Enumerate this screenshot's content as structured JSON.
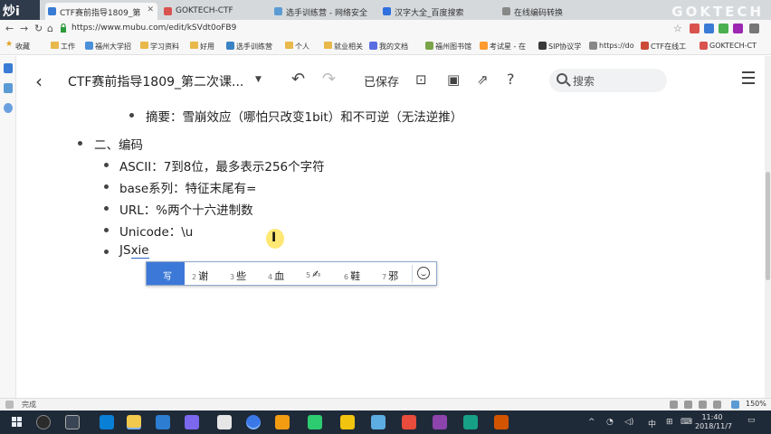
{
  "browser": {
    "avatar_text": "炒i",
    "watermark": "GOKTECH",
    "tabs": [
      {
        "label": "CTF赛前指导1809_第",
        "color": "#3a7bd5",
        "active": true
      },
      {
        "label": "GOKTECH-CTF",
        "color": "#d9534f",
        "active": false
      },
      {
        "label": "选手训练营 - 网络安全",
        "color": "#5b9bd5",
        "active": false
      },
      {
        "label": "汉字大全_百度搜索",
        "color": "#2f6fde",
        "active": false
      },
      {
        "label": "在线编码转换",
        "color": "#888888",
        "active": false
      }
    ],
    "url": "https://www.mubu.com/edit/kSVdt0oFB9"
  },
  "bookmarks": [
    {
      "label": "收藏",
      "type": "star"
    },
    {
      "label": "工作",
      "type": "folder"
    },
    {
      "label": "福州大学招",
      "type": "page",
      "color": "#4a90d9"
    },
    {
      "label": "学习资料",
      "type": "folder"
    },
    {
      "label": "好用",
      "type": "folder"
    },
    {
      "label": "选手训练营",
      "type": "page",
      "color": "#3b82c4"
    },
    {
      "label": "个人",
      "type": "folder"
    },
    {
      "label": "就业相关",
      "type": "folder"
    },
    {
      "label": "我的文档",
      "type": "page",
      "color": "#5b6ee1"
    },
    {
      "label": "福州图书馆",
      "type": "page",
      "color": "#7aa34a"
    },
    {
      "label": "考试星 - 在",
      "type": "page",
      "color": "#ff9a2e"
    },
    {
      "label": "SIP协议学",
      "type": "page",
      "color": "#3a3a3a"
    },
    {
      "label": "https://do",
      "type": "page",
      "color": "#888888"
    },
    {
      "label": "CTF在线工",
      "type": "page",
      "color": "#cc4b37"
    },
    {
      "label": "GOKTECH-CT",
      "type": "page",
      "color": "#d9534f"
    }
  ],
  "doc": {
    "title": "CTF赛前指导1809_第二次课...",
    "saved_status": "已保存",
    "search_placeholder": "搜索"
  },
  "outline": {
    "line0": "摘要：雪崩效应（哪怕只改变1bit）和不可逆（无法逆推）",
    "section": "二、编码",
    "items": [
      "ASCII：7到8位，最多表示256个字符",
      "base系列：特征末尾有=",
      "URL：%两个十六进制数",
      "Unicode：\\u"
    ],
    "current_prefix": "JS",
    "current_composing": "xie"
  },
  "ime": {
    "selected": "写",
    "candidates": [
      {
        "num": "2",
        "text": "谢"
      },
      {
        "num": "3",
        "text": "些"
      },
      {
        "num": "4",
        "text": "血"
      },
      {
        "num": "5",
        "text": "✍"
      },
      {
        "num": "6",
        "text": "鞋"
      },
      {
        "num": "7",
        "text": "邪"
      }
    ]
  },
  "statusbar": {
    "status": "完成",
    "zoom": "150%"
  },
  "taskbar": {
    "time": "11:40",
    "date": "2018/11/7",
    "lang": "中"
  }
}
